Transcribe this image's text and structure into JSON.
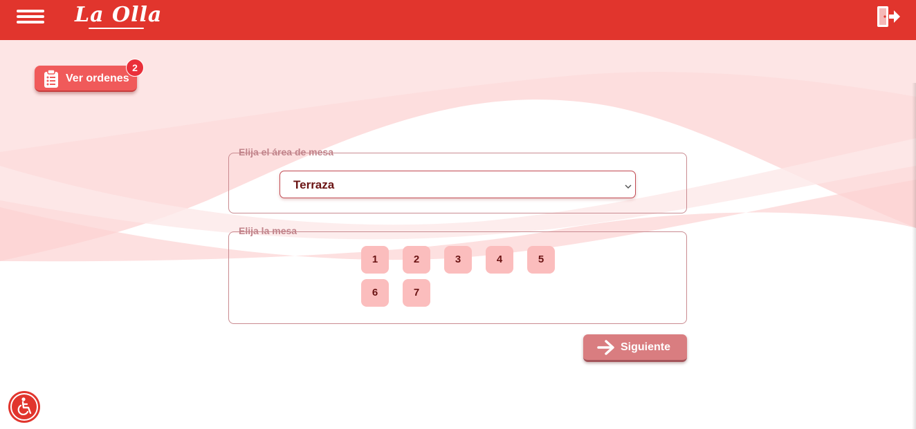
{
  "header": {
    "brand": "La Olla",
    "menu_icon": "hamburger-menu-icon",
    "logout_icon": "door-exit-icon",
    "color": "#e1352d"
  },
  "orders": {
    "label": "Ver ordenes",
    "badge_count": "2",
    "icon": "clipboard-list-icon"
  },
  "area_section": {
    "legend": "Elija el área de mesa",
    "selected": "Terraza"
  },
  "table_section": {
    "legend": "Elija la mesa",
    "tables": [
      "1",
      "2",
      "3",
      "4",
      "5",
      "6",
      "7"
    ]
  },
  "next_button": {
    "label": "Siguiente",
    "icon": "arrow-right-icon"
  },
  "accessibility": {
    "icon": "wheelchair-accessibility-icon"
  }
}
